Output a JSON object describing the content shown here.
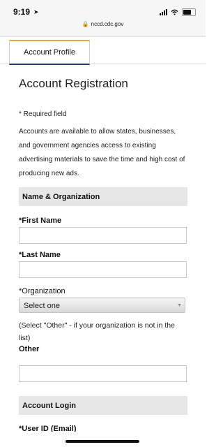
{
  "status_bar": {
    "time": "9:19",
    "url": "nccd.cdc.gov"
  },
  "tabs": {
    "active_label": "Account Profile"
  },
  "page": {
    "title": "Account Registration",
    "required_note": "* Required field",
    "intro": "Accounts are available to allow states, businesses, and government agencies access to existing advertising materials to save the time and high cost of producing new ads."
  },
  "sections": {
    "name_org": "Name & Organization",
    "account_login": "Account Login"
  },
  "form": {
    "first_name_label": "*First Name",
    "first_name_value": "",
    "last_name_label": "*Last Name",
    "last_name_value": "",
    "organization_label": "*Organization",
    "organization_selected": "Select one",
    "organization_hint": "(Select \"Other\" - if your organization is not in the list)",
    "other_label": "Other",
    "other_value": "",
    "user_id_label": "*User ID (Email)"
  },
  "icons": {
    "location": "location-arrow-icon",
    "lock": "lock-icon",
    "dropdown": "chevron-down-icon"
  }
}
